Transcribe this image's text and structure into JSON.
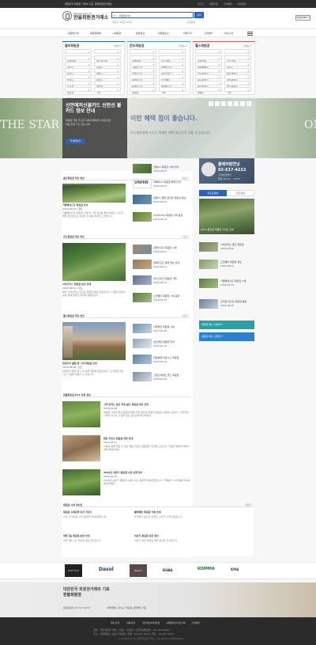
{
  "topbar": {
    "notice": "대한민국 회원권 거래의 기준, 한울회원권거래소",
    "links": [
      "로그인",
      "회원가입",
      "고객센터",
      "사이트맵"
    ]
  },
  "header": {
    "logo_small": "Membership Pro",
    "logo_name": "한울회원권거래소",
    "search_value": "회원권시세",
    "search_button": "검색",
    "search_tags": "#골프 #콘도 #헬스",
    "search_sub": "상세검색",
    "right_btn": "회원등록하기"
  },
  "nav": {
    "items": [
      "회원권시세",
      "회원권매매",
      "시세동향",
      "분양정보",
      "회원권뉴스",
      "커뮤니티",
      "고객센터",
      "회사소개"
    ],
    "menu_icon": "menu-icon"
  },
  "panels": [
    {
      "title": "골프회원권",
      "more": "전체보기",
      "accent": "#2a63b8",
      "rows": [
        [
          "지역선택",
          "골프장선택"
        ],
        [
          "경기도",
          "강원도"
        ],
        [
          "충청도",
          "경상도"
        ],
        [
          "전라도",
          "제주도"
        ],
        [
          "수도권",
          "영남권"
        ],
        [
          "호남권",
          "기타"
        ],
        [
          "전체",
          "검색"
        ]
      ]
    },
    {
      "title": "콘도회원권",
      "more": "전체보기",
      "accent": "#4aa0d5",
      "rows": [
        [
          "지역선택",
          "콘도선택"
        ],
        [
          "한화리조트",
          "대명리조트"
        ],
        [
          "금호리조트",
          "휘닉스파크"
        ],
        [
          "일성리조트",
          "오크밸리"
        ],
        [
          "용평리조트",
          "롯데리조트"
        ],
        [
          "켄싱턴",
          "기타"
        ],
        [
          "전체",
          "검색"
        ]
      ]
    },
    {
      "title": "헬스회원권",
      "more": "전체보기",
      "accent": "#e05a5a",
      "rows": [
        [
          "지역선택",
          "헬스선택"
        ],
        [
          "서울특별시",
          "경기도"
        ],
        [
          "인천광역시",
          "부산광역시"
        ],
        [
          "대구광역시",
          "광주광역시"
        ],
        [
          "대전광역시",
          "울산광역시"
        ],
        [
          "세종시",
          "기타"
        ],
        [
          "전체",
          "검색"
        ]
      ]
    }
  ],
  "banner": {
    "title": "신안에저신불카드 신안선 불카드 정보 안내",
    "overlay": "이만 혜택 점이 좋습니다.",
    "desc": "회원권 전용 카드로 다양한 혜택을 누려보세요",
    "desc2": "회원 전용 카드 정보 안내",
    "button": "자세히보기",
    "left_text": "THE STAR",
    "right_text": "ON",
    "overlay_sub": "카드회원에게 드리는 특별한 혜택 할인가격 이용 수 있습니다."
  },
  "sections": {
    "golf_news": {
      "title": "골프회원권 최신 정보",
      "more": "더보기",
      "feature_title": "가평베네스트 회원권 안내",
      "feature_sub": "2016.06.03 | 골프",
      "feature_desc": "가평베네스트 회원권 시세 및 거래 정보를 확인하세요. 수도권 명문 골프장으로 꾸준한 인기를 유지하고 있습니다.",
      "list": [
        {
          "title": "한성CC 회원권 시세 안내",
          "date": "2016.06.03"
        },
        {
          "title": "리베라CC 회원권 매매 안내",
          "date": "2016.06.03"
        },
        {
          "title": "남촌CC 명문 골프장 회원권 정보",
          "date": "2016.06.02"
        },
        {
          "title": "아시아나CC 회원권 거래 동향",
          "date": "2016.06.02"
        }
      ]
    },
    "condo_news": {
      "title": "콘도회원권 최신 정보",
      "more": "더보기",
      "feature_title": "사이프러스 회원권 분양 안내",
      "feature_sub": "2016.06.01 | 콘도",
      "feature_desc": "제주 사이프러스 리조트 회원권 분양 정보입니다. 다양한 부대시설과 함께 편안한 휴식을 제공합니다.",
      "list": [
        {
          "title": "한화리조트 회원권 시세",
          "date": "2016.06.01"
        },
        {
          "title": "대명리조트 분양 정보 안내",
          "date": "2016.06.01"
        },
        {
          "title": "휘닉스파크 회원권 거래",
          "date": "2016.05.31"
        },
        {
          "title": "오크밸리 회원권 시세 동향",
          "date": "2016.05.31"
        }
      ]
    },
    "health_news": {
      "title": "헬스회원권 최신 정보",
      "more": "더보기",
      "feature_title": "반얀트리 클럽 앤 스파 회원권 안내",
      "feature_sub": "2016.05.30 | 헬스",
      "feature_desc": "반얀트리 클럽 앤 스파 서울 회원권 정보입니다. 프리미엄 피트니스 시설을 이용할 수 있습니다.",
      "list": [
        {
          "title": "서울클럽 회원권 시세",
          "date": "2016.05.30"
        },
        {
          "title": "남산클럽 회원권 안내",
          "date": "2016.05.30"
        },
        {
          "title": "타워호텔 피트니스 회원권",
          "date": "2016.05.29"
        },
        {
          "title": "그랜드하얏트 헬스 회원권",
          "date": "2016.05.29"
        }
      ]
    },
    "column": {
      "title": "한울회원권 Pick 추천 정보",
      "items": [
        {
          "title": "고객 만족도 높은 추천 골프 회원권 정보 안내",
          "date": "2016.05.28",
          "desc": "회원권 시장의 최신 동향과 함께 추천 골프장 회원권 정보를 안내해 드립니다. 합리적인 가격과 우수한 시설을 갖춘 골프장을 확인하세요."
        },
        {
          "title": "명문 리조트 회원권 추천 안내",
          "date": "2016.05.27",
          "desc": "가족과 함께 즐길 수 있는 명문 리조트 회원권을 추천해 드립니다. 다양한 혜택과 부대시설을 확인하세요."
        },
        {
          "title": "2016년 상반기 회원권 시장 동향 정리",
          "date": "2016.05.26",
          "desc": "2016년 상반기 회원권 시장의 주요 동향을 정리하였습니다. 거래량과 시세 변동 추이를 확인하세요."
        }
      ]
    },
    "board": {
      "title": "회원권 시세 게시판",
      "more": "더보기",
      "left": [
        {
          "title": "회원권 시세동향 주간 리포트",
          "desc": "이번 주 회원권 시세 동향을 정리하였습니다."
        },
        {
          "title": "대명그룹 회원권 분양 안내",
          "desc": "대명그룹 신규 회원권 분양 정보입니다."
        }
      ],
      "right": [
        {
          "title": "블루헤런 회원권 거래 안내",
          "desc": "블루헤런 골프장 회원권 시세 및 거래 정보입니다."
        },
        {
          "title": "아난티 회원권 분양 정보",
          "desc": "아난티 클럽 회원권 분양 정보를 안내합니다."
        }
      ]
    }
  },
  "sidebar": {
    "ad_title": "출레어판연닝",
    "phone": "02-517-4222",
    "phone_label": "고객상담센터",
    "ad_caption": "평일 09:00 ~ 18:00",
    "tabs": [
      "리조트분양",
      "골프분양"
    ],
    "feature_title": "2016 골프장 회원권 가이드 안내",
    "feature_date": "2016.06.03",
    "list": [
      {
        "title": "사이프러스 골프 회원권",
        "date": "2016.06.02"
      },
      {
        "title": "오크밸리 회원권 정보",
        "date": "2016.06.01"
      },
      {
        "title": "가평베네스트 회원권 시세",
        "date": "2016.05.31"
      },
      {
        "title": "곤지암 리조트 회원권 분양",
        "date": "2016.05.30"
      }
    ],
    "btn1": "회원권 매수 신청하기",
    "btn2": "회원권 매도 신청하기"
  },
  "partners": {
    "logos": [
      "Golf Club",
      "Dasol",
      "Resort",
      "KGBA",
      "KOMMA",
      "KMA"
    ]
  },
  "footer_banner": {
    "title": "대한민국 회원권거래의 기표",
    "title2": "한울회원권",
    "phone": "회원권상담 02-517-4222",
    "address": "서울특별시 강남구 역삼동 한울빌딩 3층"
  },
  "footer": {
    "links": [
      "회사소개",
      "이용약관",
      "개인정보처리방침",
      "이메일무단수집거부",
      "고객센터"
    ],
    "info1": "상호 : 한울회원권거래소 | 대표 : 홍길동 | 사업자등록번호 : 123-45-67890",
    "info2": "주소 : 서울특별시 강남구 역삼동 | 전화 : 02-517-4222 | 팩스 : 02-517-4223",
    "copyright": "COPYRIGHT (C) 한울회원권거래소. ALL RIGHTS RESERVED."
  },
  "colors": {
    "brand_blue": "#2a63b8",
    "teal": "#27a1a8",
    "dark_footer": "#2b2b2b"
  }
}
